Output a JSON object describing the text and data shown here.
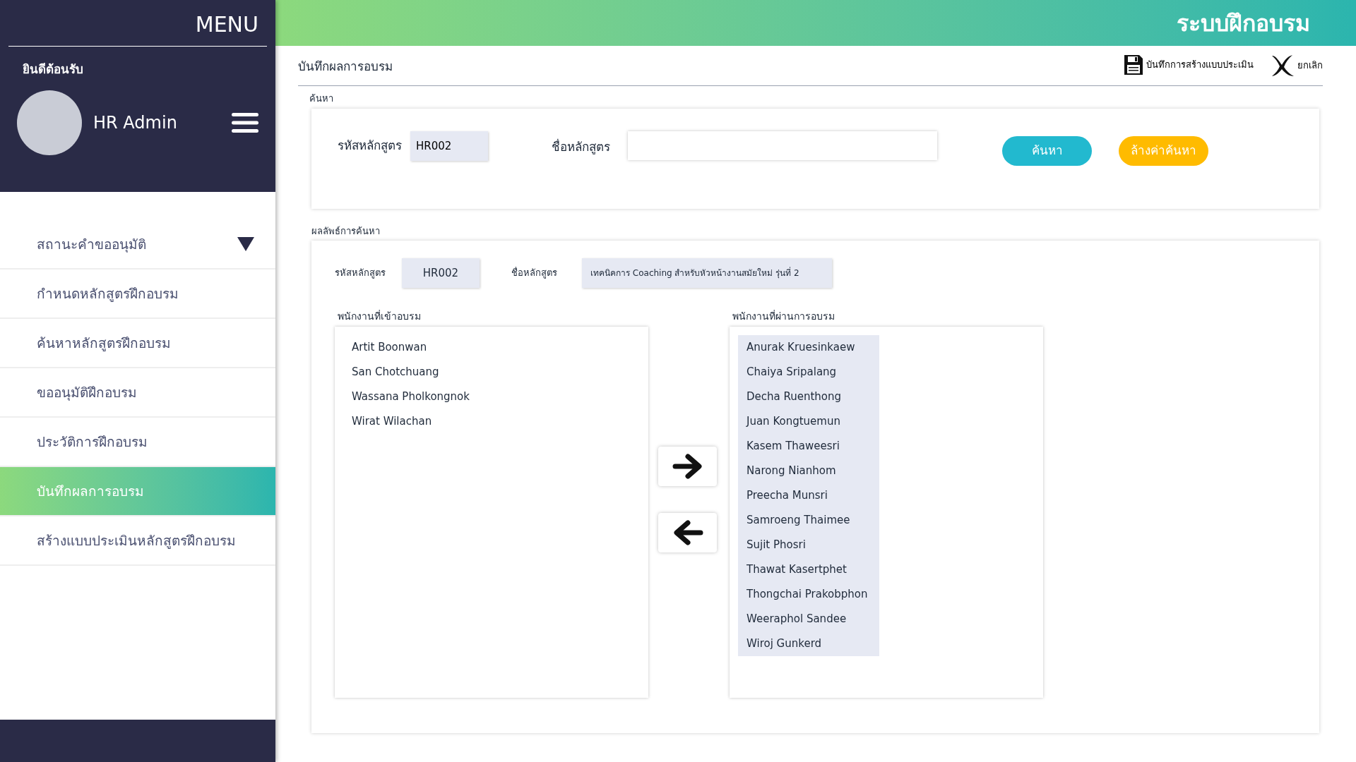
{
  "sidebar": {
    "menu_title": "MENU",
    "welcome": "ยินดีต้อนรับ",
    "user_name": "HR Admin",
    "items": [
      {
        "label": "สถานะคำขออนุมัติ",
        "kind": "dropdown",
        "selected": false
      },
      {
        "label": "กำหนดหลักสูตรฝึกอบรม",
        "kind": "link",
        "selected": false
      },
      {
        "label": "ค้นหาหลักสูตรฝึกอบรม",
        "kind": "link",
        "selected": false
      },
      {
        "label": "ขออนุมัติฝึกอบรม",
        "kind": "link",
        "selected": false
      },
      {
        "label": "ประวัติการฝึกอบรม",
        "kind": "link",
        "selected": false
      },
      {
        "label": "บันทึกผลการอบรม",
        "kind": "link",
        "selected": true
      },
      {
        "label": "สร้างแบบประเมินหลักสูตรฝึกอบรม",
        "kind": "link",
        "selected": false
      }
    ]
  },
  "header": {
    "title": "ระบบฝึกอบรม"
  },
  "page": {
    "title": "บันทึกผลการอบรม",
    "actions": [
      {
        "label": "บันทึกการสร้างแบบประเมิน",
        "kind": "save"
      },
      {
        "label": "ยกเลิก",
        "kind": "cancel"
      }
    ]
  },
  "search": {
    "section_label": "ค้นหา",
    "code_label": "รหัสหลักสูตร",
    "code_value": "HR002",
    "name_label": "ชื่อหลักสูตร",
    "search_button": "ค้นหา",
    "clear_button": "ล้างค่าค้นหา"
  },
  "results": {
    "section_label": "ผลลัพธ์การค้นหา",
    "code_label": "รหัสหลักสูตร",
    "code_value": "HR002",
    "name_label": "ชื่อหลักสูตร",
    "name_value": "เทคนิคการ Coaching สำหรับหัวหน้างานสมัยใหม่ รุ่นที่ 2",
    "attendees": {
      "label": "พนักงานที่เข้าอบรม",
      "items": [
        {
          "name": "Artit Boonwan",
          "selected": false
        },
        {
          "name": "San Chotchuang",
          "selected": false
        },
        {
          "name": "Wassana Pholkongnok",
          "selected": false
        },
        {
          "name": "Wirat Wilachan",
          "selected": false
        }
      ]
    },
    "passed": {
      "label": "พนักงานที่ผ่านการอบรม",
      "items": [
        {
          "name": "Anurak Kruesinkaew",
          "selected": true
        },
        {
          "name": "Chaiya Sripalang",
          "selected": true
        },
        {
          "name": "Decha Ruenthong",
          "selected": true
        },
        {
          "name": "Juan Kongtuemun",
          "selected": true
        },
        {
          "name": "Kasem Thaweesri",
          "selected": true
        },
        {
          "name": "Narong Nianhom",
          "selected": true
        },
        {
          "name": "Preecha Munsri",
          "selected": true
        },
        {
          "name": "Samroeng Thaimee",
          "selected": true
        },
        {
          "name": "Sujit Phosri",
          "selected": true
        },
        {
          "name": "Thawat Kasertphet",
          "selected": true
        },
        {
          "name": "Thongchai Prakobphon",
          "selected": true
        },
        {
          "name": "Weeraphol Sandee",
          "selected": true
        },
        {
          "name": "Wiroj Gunkerd",
          "selected": true
        }
      ]
    }
  }
}
